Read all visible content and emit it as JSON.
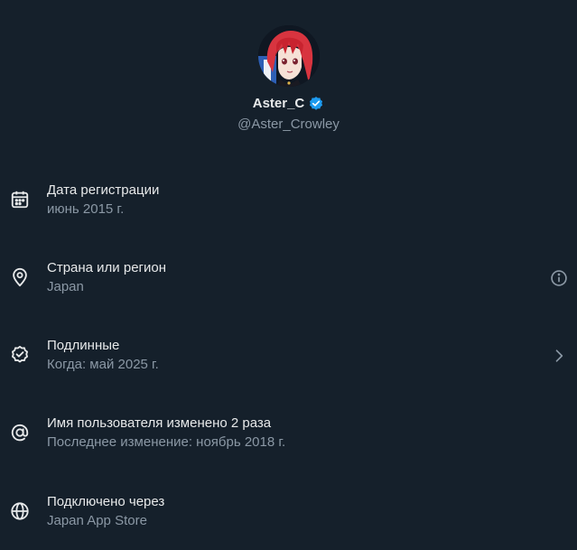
{
  "profile": {
    "display_name": "Aster_C",
    "handle": "@Aster_Crowley",
    "verified": true,
    "accent_color": "#1d9bf0"
  },
  "rows": [
    {
      "icon": "calendar-icon",
      "title": "Дата регистрации",
      "subtitle": "июнь 2015 г."
    },
    {
      "icon": "location-pin-icon",
      "title": "Страна или регион",
      "subtitle": "Japan",
      "action_icon": "info-icon"
    },
    {
      "icon": "verified-badge-icon",
      "title": "Подлинные",
      "subtitle": "Когда: май 2025 г.",
      "action_icon": "chevron-right-icon"
    },
    {
      "icon": "at-sign-icon",
      "title": "Имя пользователя изменено 2 раза",
      "subtitle": "Последнее изменение: ноябрь 2018 г."
    },
    {
      "icon": "globe-icon",
      "title": "Подключено через",
      "subtitle": "Japan App Store"
    }
  ],
  "colors": {
    "background": "#15202b",
    "primary_text": "#e7e9ea",
    "secondary_text": "#8b98a5"
  }
}
